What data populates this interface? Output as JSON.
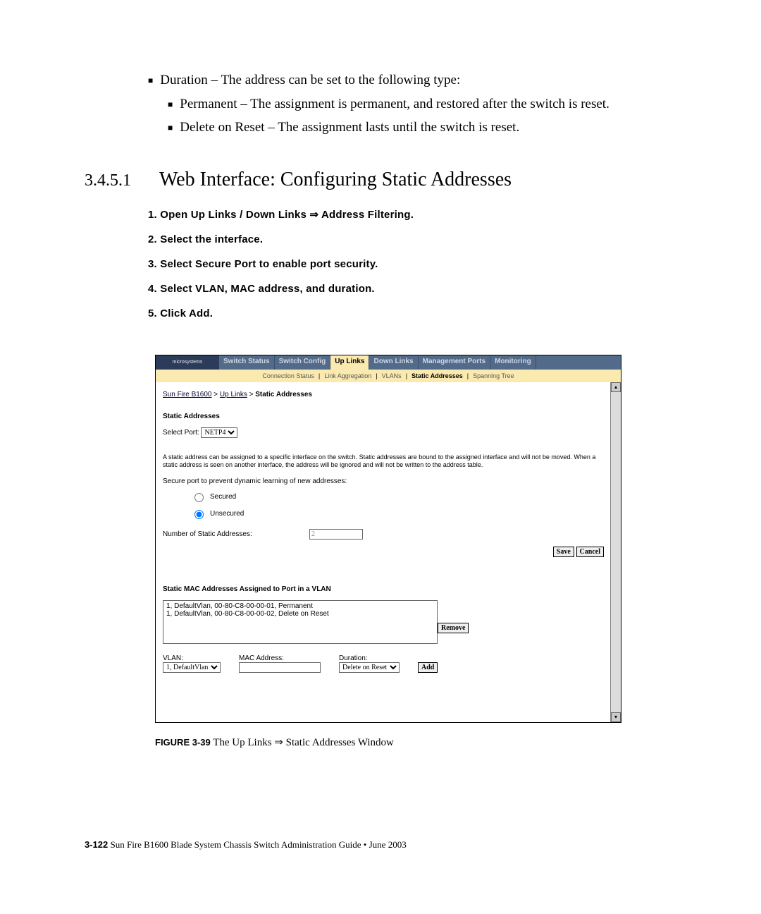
{
  "intro": {
    "duration": "Duration – The address can be set to the following type:",
    "permanent": "Permanent – The assignment is permanent, and restored after the switch is reset.",
    "delete": "Delete on Reset – The assignment lasts until the switch is reset."
  },
  "section": {
    "num": "3.4.5.1",
    "title": "Web Interface: Configuring Static Addresses"
  },
  "steps": {
    "s1": "1. Open Up Links / Down Links ⇒ Address Filtering.",
    "s2": "2. Select the interface.",
    "s3": "3. Select Secure Port to enable port security.",
    "s4": "4. Select VLAN, MAC address, and duration.",
    "s5": "5. Click Add."
  },
  "ui": {
    "tabs": {
      "t1": "Switch Status",
      "t2": "Switch Config",
      "t3": "Up Links",
      "t4": "Down Links",
      "t5": "Management Ports",
      "t6": "Monitoring"
    },
    "sub": {
      "a": "Connection Status",
      "b": "Link Aggregation",
      "c": "VLANs",
      "d": "Static Addresses",
      "e": "Spanning Tree"
    },
    "crumb": {
      "a": "Sun Fire B1600",
      "b": "Up Links",
      "c": "Static Addresses"
    },
    "heading": "Static Addresses",
    "portlabel": "Select Port:",
    "portval": "NETP4",
    "desc": "A static address can be assigned to a specific interface on the switch. Static addresses are bound to the assigned interface and will not be moved. When a static address is seen on another interface, the address will be ignored and will not be written to the address table.",
    "secure": "Secure port to prevent dynamic learning of new addresses:",
    "r1": "Secured",
    "r2": "Unsecured",
    "numlabel": "Number of Static Addresses:",
    "numval": "2",
    "save": "Save",
    "cancel": "Cancel",
    "list_title": "Static MAC Addresses Assigned to Port in a VLAN",
    "li1": "1, DefaultVlan, 00-80-C8-00-00-01, Permanent",
    "li2": "1, DefaultVlan, 00-80-C8-00-00-02, Delete on Reset",
    "remove": "Remove",
    "vlanlbl": "VLAN:",
    "vlanval": "1, DefaultVlan",
    "maclbl": "MAC Address:",
    "durlbl": "Duration:",
    "durval": "Delete on Reset",
    "add": "Add"
  },
  "caption": {
    "label": "FIGURE 3-39",
    "text": "  The Up Links ⇒ Static Addresses Window"
  },
  "footer": {
    "page": "3-122",
    "text": "    Sun Fire B1600 Blade System Chassis Switch Administration Guide • June 2003"
  }
}
